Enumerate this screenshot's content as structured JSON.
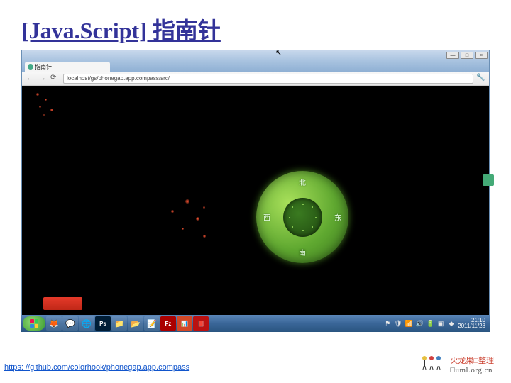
{
  "slide": {
    "title": "[Java.Script] 指南针"
  },
  "browser": {
    "tab_title": "指南针",
    "url": "localhost/gs/phonegap.app.compass/src/",
    "window_buttons": {
      "min": "—",
      "max": "□",
      "close": "×"
    },
    "nav": {
      "back": "←",
      "forward": "→",
      "reload": "⟳",
      "wrench": "🔧"
    }
  },
  "compass": {
    "north": "北",
    "south": "南",
    "east": "东",
    "west": "西"
  },
  "taskbar": {
    "apps": [
      {
        "name": "firefox",
        "glyph": "🦊"
      },
      {
        "name": "gtalk",
        "glyph": "💬"
      },
      {
        "name": "chrome",
        "glyph": "🌐"
      },
      {
        "name": "photoshop",
        "glyph": "Ps"
      },
      {
        "name": "explorer",
        "glyph": "📁"
      },
      {
        "name": "folder",
        "glyph": "📂"
      },
      {
        "name": "notepad",
        "glyph": "📝"
      },
      {
        "name": "filezilla",
        "glyph": "Fz"
      },
      {
        "name": "powerpoint",
        "glyph": "📊"
      },
      {
        "name": "acrobat",
        "glyph": "📕"
      }
    ],
    "tray": [
      {
        "name": "flag",
        "glyph": "⚑"
      },
      {
        "name": "shield",
        "glyph": "🛡"
      },
      {
        "name": "network",
        "glyph": "📶"
      },
      {
        "name": "sound",
        "glyph": "🔊"
      },
      {
        "name": "battery",
        "glyph": "🔋"
      },
      {
        "name": "app1",
        "glyph": "▣"
      },
      {
        "name": "app2",
        "glyph": "◆"
      }
    ],
    "time": "21:10",
    "date": "2011/11/28"
  },
  "footer": {
    "link_text": "https: //github.com/colorhook/phonegap.app.compass"
  },
  "branding": {
    "line1": "火龙果□整理",
    "line2": "□uml.org.cn"
  },
  "colors": {
    "ps": "#001d36",
    "fz": "#a00",
    "ppt": "#d24726",
    "pdf": "#b11"
  }
}
